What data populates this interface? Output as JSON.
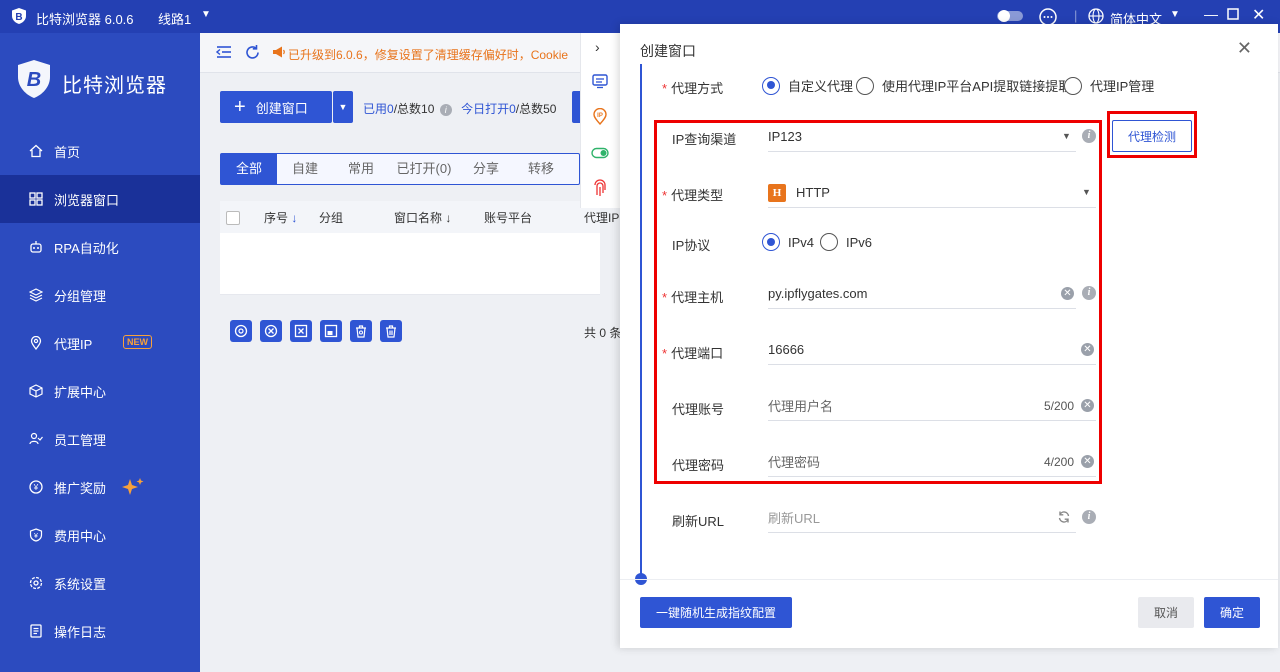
{
  "window": {
    "title": "比特浏览器 6.0.6",
    "route": "线路1",
    "language": "简体中文"
  },
  "sidebar": {
    "brand": "比特浏览器",
    "new_badge": "NEW",
    "items": [
      {
        "label": "首页",
        "icon": "home-icon"
      },
      {
        "label": "浏览器窗口",
        "icon": "grid-icon"
      },
      {
        "label": "RPA自动化",
        "icon": "robot-icon"
      },
      {
        "label": "分组管理",
        "icon": "layers-icon"
      },
      {
        "label": "代理IP",
        "icon": "location-icon"
      },
      {
        "label": "扩展中心",
        "icon": "cube-icon"
      },
      {
        "label": "员工管理",
        "icon": "users-icon"
      },
      {
        "label": "推广奖励",
        "icon": "reward-icon"
      },
      {
        "label": "费用中心",
        "icon": "shield-yen-icon"
      },
      {
        "label": "系统设置",
        "icon": "gear-icon"
      },
      {
        "label": "操作日志",
        "icon": "log-icon"
      }
    ]
  },
  "main": {
    "notice": "已升级到6.0.6，修复设置了清理缓存偏好时，Cookie",
    "create_button": "创建窗口",
    "usage": {
      "used_label": "已用",
      "used": "0",
      "total": "/总数10",
      "opened_label": "今日打开",
      "opened": "0",
      "opened_total": "/总数50"
    },
    "tabs": [
      "全部",
      "自建",
      "常用",
      "已打开(0)",
      "分享",
      "转移"
    ],
    "columns": [
      "序号",
      "分组",
      "窗口名称",
      "账号平台",
      "代理IP"
    ],
    "total_text": "共 0 条"
  },
  "modal": {
    "title": "创建窗口",
    "proxy_mode": {
      "label": "代理方式",
      "options": [
        "自定义代理",
        "使用代理IP平台API提取链接提取",
        "代理IP管理"
      ]
    },
    "ip_channel": {
      "label": "IP查询渠道",
      "value": "IP123"
    },
    "proxy_type": {
      "label": "代理类型",
      "value": "HTTP",
      "badge": "H"
    },
    "ip_protocol": {
      "label": "IP协议",
      "options": [
        "IPv4",
        "IPv6"
      ]
    },
    "proxy_host": {
      "label": "代理主机",
      "value": "py.ipflygates.com"
    },
    "proxy_port": {
      "label": "代理端口",
      "value": "16666"
    },
    "proxy_account": {
      "label": "代理账号",
      "placeholder": "代理用户名",
      "count": "5/200"
    },
    "proxy_password": {
      "label": "代理密码",
      "placeholder": "代理密码",
      "count": "4/200"
    },
    "refresh_url": {
      "label": "刷新URL",
      "placeholder": "刷新URL"
    },
    "check_button": "代理检测",
    "random_button": "一键随机生成指纹配置",
    "cancel_button": "取消",
    "confirm_button": "确定"
  },
  "colors": {
    "accent": "#2f55d4",
    "sidebar": "#2c4bbf",
    "highlight": "#e00000"
  }
}
